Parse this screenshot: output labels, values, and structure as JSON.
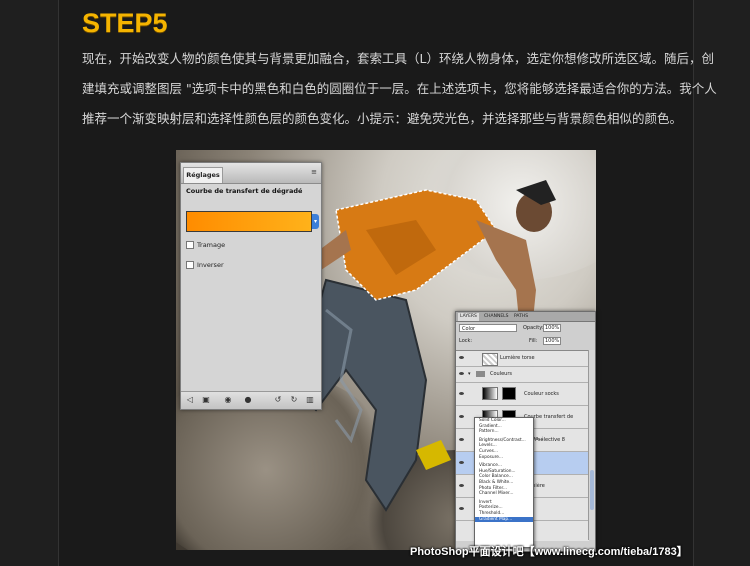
{
  "step_title": "STEP5",
  "paragraph": {
    "line1": "现在，开始改变人物的颜色使其与背景更加融合，套索工具（L）环绕人物身体，选定你想修改所选区域。随后，创",
    "line2": "建填充或调整图层 \"选项卡中的黑色和白色的圆圈位于一层。在上述选项卡，您将能够选择最适合你的方法。我个人",
    "line3": "推荐一个渐变映射层和选择性颜色层的颜色变化。小提示：避免荧光色，并选择那些与背景颜色相似的颜色。"
  },
  "reglages": {
    "tab": "Réglages",
    "heading": "Courbe de transfert de dégradé",
    "gradient_colors": [
      "#ff8c00",
      "#ffb21a"
    ],
    "checkbox_dither": "Tramage",
    "checkbox_reverse": "Inverser"
  },
  "layers": {
    "tabs": [
      "LAYERS",
      "CHANNELS",
      "PATHS"
    ],
    "blend_mode": "Color",
    "opacity_label": "Opacity:",
    "opacity_value": "100%",
    "lock_label": "Lock:",
    "fill_label": "Fill:",
    "fill_value": "100%",
    "items": [
      {
        "name": "Lumière torse"
      },
      {
        "name": "Couleurs"
      },
      {
        "name": "Couleur socks"
      },
      {
        "name": "Courbe transfert de dégra..."
      },
      {
        "name": "ction sélective 8"
      },
      {
        "name": "dernière"
      },
      {
        "name": "s"
      }
    ]
  },
  "dropdown": {
    "group1": [
      "Solid Color...",
      "Gradient...",
      "Pattern..."
    ],
    "group2": [
      "Brightness/Contrast...",
      "Levels...",
      "Curves...",
      "Exposure..."
    ],
    "group3": [
      "Vibrance...",
      "Hue/Saturation...",
      "Color Balance...",
      "Black & White...",
      "Photo Filter...",
      "Channel Mixer..."
    ],
    "group4": [
      "Invert",
      "Posterize...",
      "Threshold...",
      "Gradient Map..."
    ]
  },
  "watermark": "PhotoShop平面设计吧【www.linecg.com/tieba/1783】"
}
